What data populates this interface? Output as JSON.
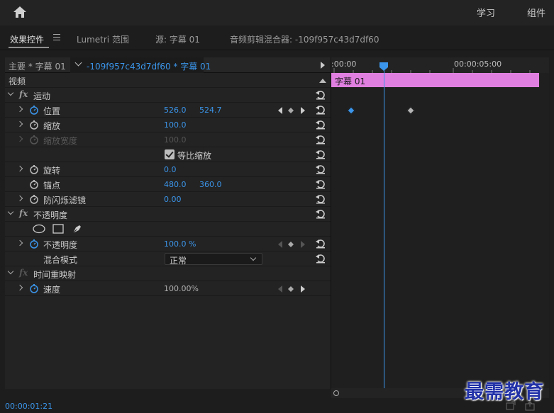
{
  "topbar": {
    "learn_label": "学习",
    "components_label": "组件"
  },
  "tabs": {
    "effect_controls": "效果控件",
    "lumetri_scopes": "Lumetri 范围",
    "source": "源: 字幕 01",
    "audio_mixer": "音频剪辑混合器: -109f957c43d7df60"
  },
  "clip_bar": {
    "master": "主要 * 字幕 01",
    "sequence": "-109f957c43d7df60 * 字幕 01"
  },
  "sections": {
    "video": "视频",
    "motion": "运动",
    "opacity": "不透明度",
    "time_remap": "时间重映射"
  },
  "properties": {
    "position": {
      "label": "位置",
      "x": "526.0",
      "y": "524.7"
    },
    "scale": {
      "label": "缩放",
      "value": "100.0"
    },
    "scale_width": {
      "label": "缩放宽度",
      "value": "100.0"
    },
    "uniform_scale": {
      "label": "等比缩放",
      "checked": true
    },
    "rotation": {
      "label": "旋转",
      "value": "0.0"
    },
    "anchor": {
      "label": "锚点",
      "x": "480.0",
      "y": "360.0"
    },
    "anti_flicker": {
      "label": "防闪烁滤镜",
      "value": "0.00"
    },
    "opacity": {
      "label": "不透明度",
      "value": "100.0 %"
    },
    "blend_mode": {
      "label": "混合模式",
      "value": "正常"
    },
    "speed": {
      "label": "速度",
      "value": "100.00%"
    }
  },
  "timeline": {
    "tc_start": ":00:00",
    "tc_mid": "00:00:05:00",
    "clip_name": "字幕 01"
  },
  "status": {
    "timecode": "00:00:01:21"
  },
  "watermark": "最需教育",
  "colors": {
    "accent": "#3b95ea",
    "clip": "#e07fe0",
    "panel": "#232323"
  }
}
